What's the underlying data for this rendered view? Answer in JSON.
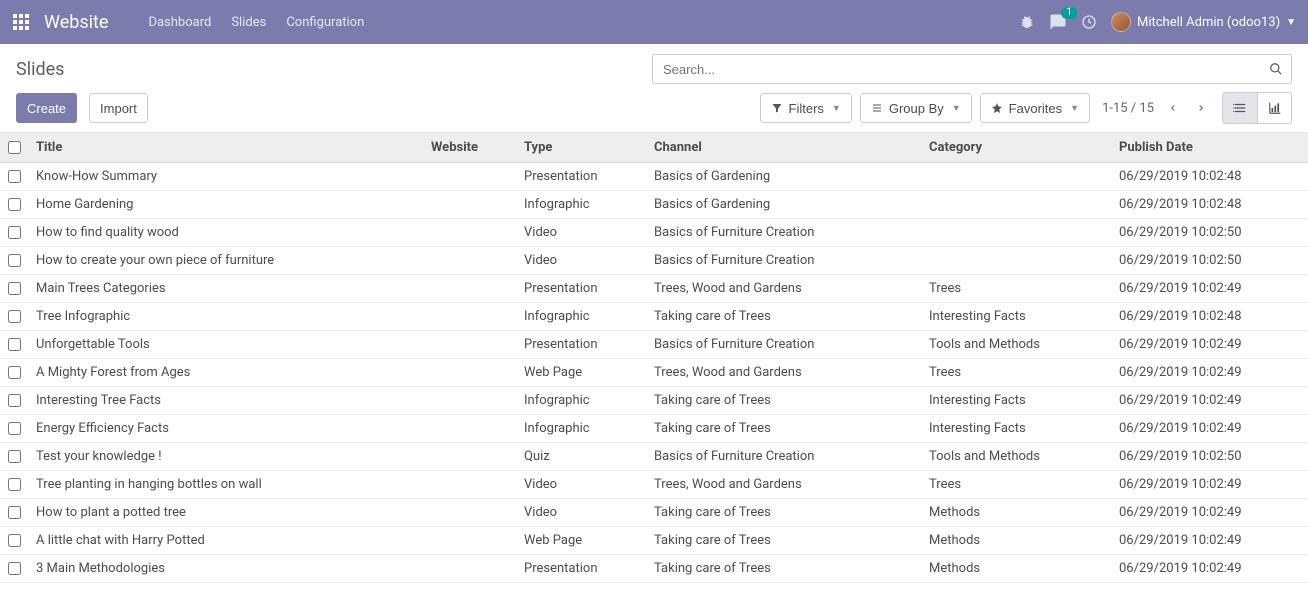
{
  "topnav": {
    "brand": "Website",
    "links": [
      "Dashboard",
      "Slides",
      "Configuration"
    ],
    "messages_badge": "1",
    "user": "Mitchell Admin (odoo13)"
  },
  "breadcrumb": "Slides",
  "buttons": {
    "create": "Create",
    "import": "Import",
    "filters": "Filters",
    "groupby": "Group By",
    "favorites": "Favorites"
  },
  "search": {
    "placeholder": "Search..."
  },
  "pager": {
    "range": "1-15 / 15"
  },
  "columns": {
    "title": "Title",
    "website": "Website",
    "type": "Type",
    "channel": "Channel",
    "category": "Category",
    "publish_date": "Publish Date"
  },
  "rows": [
    {
      "title": "Know-How Summary",
      "website": "",
      "type": "Presentation",
      "channel": "Basics of Gardening",
      "category": "",
      "publish_date": "06/29/2019 10:02:48"
    },
    {
      "title": "Home Gardening",
      "website": "",
      "type": "Infographic",
      "channel": "Basics of Gardening",
      "category": "",
      "publish_date": "06/29/2019 10:02:48"
    },
    {
      "title": "How to find quality wood",
      "website": "",
      "type": "Video",
      "channel": "Basics of Furniture Creation",
      "category": "",
      "publish_date": "06/29/2019 10:02:50"
    },
    {
      "title": "How to create your own piece of furniture",
      "website": "",
      "type": "Video",
      "channel": "Basics of Furniture Creation",
      "category": "",
      "publish_date": "06/29/2019 10:02:50"
    },
    {
      "title": "Main Trees Categories",
      "website": "",
      "type": "Presentation",
      "channel": "Trees, Wood and Gardens",
      "category": "Trees",
      "publish_date": "06/29/2019 10:02:49"
    },
    {
      "title": "Tree Infographic",
      "website": "",
      "type": "Infographic",
      "channel": "Taking care of Trees",
      "category": "Interesting Facts",
      "publish_date": "06/29/2019 10:02:48"
    },
    {
      "title": "Unforgettable Tools",
      "website": "",
      "type": "Presentation",
      "channel": "Basics of Furniture Creation",
      "category": "Tools and Methods",
      "publish_date": "06/29/2019 10:02:49"
    },
    {
      "title": "A Mighty Forest from Ages",
      "website": "",
      "type": "Web Page",
      "channel": "Trees, Wood and Gardens",
      "category": "Trees",
      "publish_date": "06/29/2019 10:02:49"
    },
    {
      "title": "Interesting Tree Facts",
      "website": "",
      "type": "Infographic",
      "channel": "Taking care of Trees",
      "category": "Interesting Facts",
      "publish_date": "06/29/2019 10:02:49"
    },
    {
      "title": "Energy Efficiency Facts",
      "website": "",
      "type": "Infographic",
      "channel": "Taking care of Trees",
      "category": "Interesting Facts",
      "publish_date": "06/29/2019 10:02:49"
    },
    {
      "title": "Test your knowledge !",
      "website": "",
      "type": "Quiz",
      "channel": "Basics of Furniture Creation",
      "category": "Tools and Methods",
      "publish_date": "06/29/2019 10:02:50"
    },
    {
      "title": "Tree planting in hanging bottles on wall",
      "website": "",
      "type": "Video",
      "channel": "Trees, Wood and Gardens",
      "category": "Trees",
      "publish_date": "06/29/2019 10:02:49"
    },
    {
      "title": "How to plant a potted tree",
      "website": "",
      "type": "Video",
      "channel": "Taking care of Trees",
      "category": "Methods",
      "publish_date": "06/29/2019 10:02:49"
    },
    {
      "title": "A little chat with Harry Potted",
      "website": "",
      "type": "Web Page",
      "channel": "Taking care of Trees",
      "category": "Methods",
      "publish_date": "06/29/2019 10:02:49"
    },
    {
      "title": "3 Main Methodologies",
      "website": "",
      "type": "Presentation",
      "channel": "Taking care of Trees",
      "category": "Methods",
      "publish_date": "06/29/2019 10:02:49"
    }
  ]
}
